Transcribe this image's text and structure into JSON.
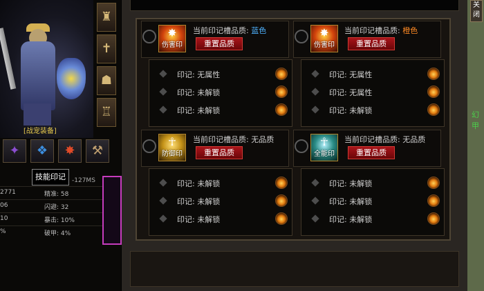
{
  "character": {
    "gear_label": "[战宠装备]",
    "tooltip": "技能印记",
    "ms": "-127MS",
    "stats": [
      {
        "left": "2771",
        "right": "精准: 58"
      },
      {
        "left": "06",
        "right": "闪避: 32"
      },
      {
        "left": "10",
        "right": "暴击: 10%"
      },
      {
        "left": "%",
        "right": "破甲: 4%"
      }
    ],
    "equip_slots": [
      {
        "icon": "helmet-icon",
        "glyph": "♜"
      },
      {
        "icon": "cross-icon",
        "glyph": "✝"
      },
      {
        "icon": "beast-icon",
        "glyph": "☗"
      },
      {
        "icon": "armor-icon",
        "glyph": "♖"
      }
    ],
    "skill_slots": [
      {
        "icon": "purple-wing-icon",
        "glyph": "✦",
        "color": "#8a4dcf"
      },
      {
        "icon": "blue-sigil-icon",
        "glyph": "❖",
        "color": "#3c8fe0"
      },
      {
        "icon": "red-warrior-icon",
        "glyph": "✸",
        "color": "#e04a28"
      },
      {
        "icon": "axe-icon",
        "glyph": "⚒",
        "color": "#c0a070"
      }
    ]
  },
  "panel": {
    "close_label": "关闭",
    "side_char": "幻甲",
    "quality_prefix": "当前印记槽品质:",
    "reset_label": "重置品质",
    "slots": [
      {
        "badge": "伤害印",
        "quality": "蓝色",
        "quality_color": "#4fb3ff",
        "inscriptions": [
          "印记: 无属性",
          "印记: 未解锁",
          "印记: 未解锁"
        ]
      },
      {
        "badge": "伤害印",
        "quality": "橙色",
        "quality_color": "#ff8a24",
        "inscriptions": [
          "印记: 无属性",
          "印记: 无属性",
          "印记: 未解锁"
        ]
      },
      {
        "badge": "防御印",
        "quality": "无品质",
        "quality_color": "#cfcfcf",
        "inscriptions": [
          "印记: 未解锁",
          "印记: 未解锁",
          "印记: 未解锁"
        ]
      },
      {
        "badge": "全能印",
        "quality": "无品质",
        "quality_color": "#cfcfcf",
        "inscriptions": [
          "印记: 未解锁",
          "印记: 未解锁",
          "印记: 未解锁"
        ]
      }
    ]
  }
}
